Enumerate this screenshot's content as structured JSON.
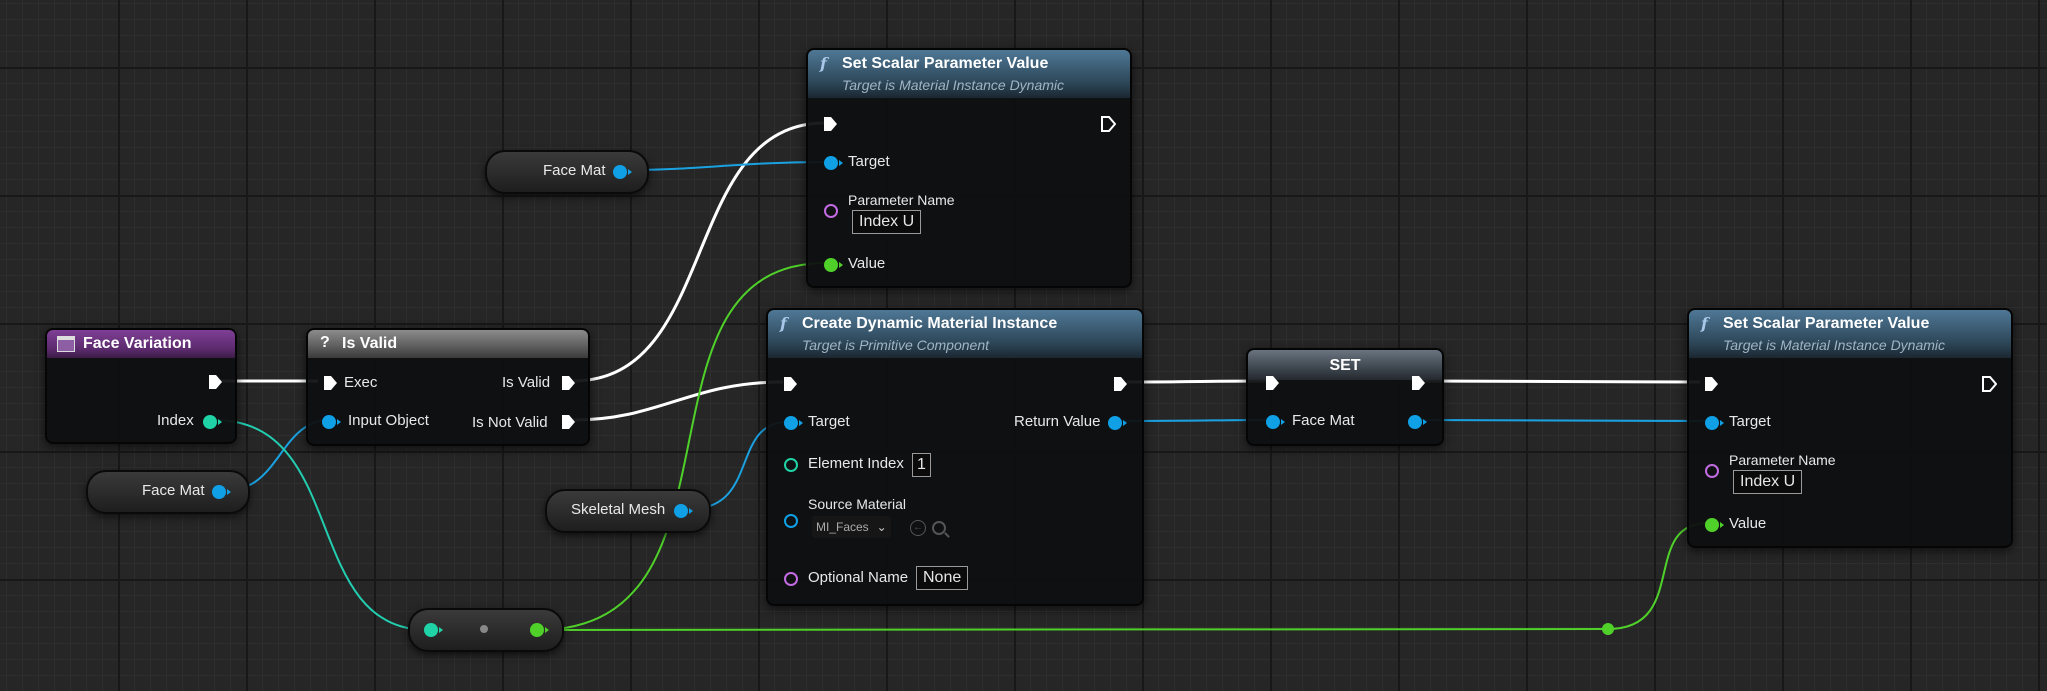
{
  "colors": {
    "exec_wire": "#ffffff",
    "object_wire": "#1aa1e0",
    "int_wire": "#22cdb0",
    "float_wire": "#4fd12a",
    "name_pin": "#c26be3"
  },
  "nodes": {
    "face_variation": {
      "title": "Face Variation",
      "icon": "table-icon",
      "pins": {
        "index": "Index"
      }
    },
    "is_valid": {
      "title": "Is Valid",
      "icon": "question-mark-icon",
      "pins": {
        "exec": "Exec",
        "input_object": "Input Object",
        "is_valid": "Is Valid",
        "is_not_valid": "Is Not Valid"
      }
    },
    "face_mat_get_top": {
      "label": "Face Mat"
    },
    "face_mat_get_left": {
      "label": "Face Mat"
    },
    "skeletal_mesh_get": {
      "label": "Skeletal Mesh"
    },
    "set_scalar_1": {
      "title": "Set Scalar Parameter Value",
      "subtitle": "Target is Material Instance Dynamic",
      "icon": "function-icon",
      "pins": {
        "target": "Target",
        "parameter_name": "Parameter Name",
        "parameter_value": "Index U",
        "value": "Value"
      }
    },
    "create_dmi": {
      "title": "Create Dynamic Material Instance",
      "subtitle": "Target is Primitive Component",
      "icon": "function-icon",
      "pins": {
        "target": "Target",
        "return_value": "Return Value",
        "element_index": "Element Index",
        "element_index_value": "1",
        "source_material": "Source Material",
        "source_material_value": "MI_Faces",
        "optional_name": "Optional Name",
        "optional_name_value": "None"
      }
    },
    "set_var": {
      "title": "SET",
      "pins": {
        "face_mat": "Face Mat"
      }
    },
    "set_scalar_2": {
      "title": "Set Scalar Parameter Value",
      "subtitle": "Target is Material Instance Dynamic",
      "icon": "function-icon",
      "pins": {
        "target": "Target",
        "parameter_name": "Parameter Name",
        "parameter_value": "Index U",
        "value": "Value"
      }
    },
    "conversion": {
      "icon": "conversion-dot-icon"
    }
  }
}
